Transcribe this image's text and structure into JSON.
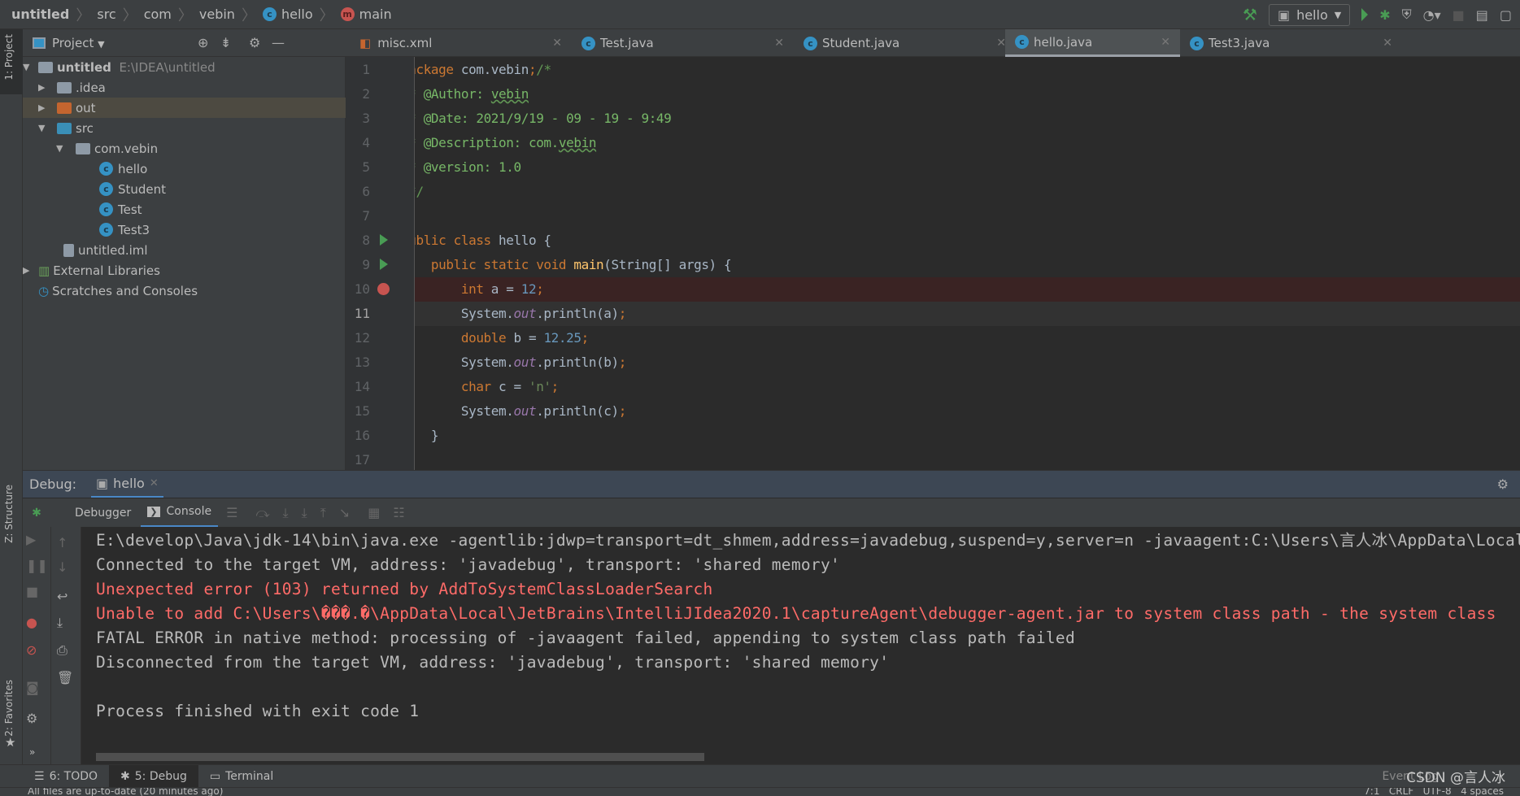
{
  "navbar": {
    "crumbs": [
      "untitled",
      "src",
      "com",
      "vebin",
      "hello",
      "main"
    ]
  },
  "toolbar": {
    "run_config": "hello"
  },
  "sidebar": {
    "project_tab": "1: Project",
    "structure_tab": "Z: Structure",
    "favorites_tab": "2: Favorites"
  },
  "project": {
    "title": "Project",
    "items": [
      {
        "label": "untitled",
        "path": "E:\\IDEA\\untitled"
      },
      {
        "label": ".idea"
      },
      {
        "label": "out"
      },
      {
        "label": "src"
      },
      {
        "label": "com.vebin"
      },
      {
        "label": "hello"
      },
      {
        "label": "Student"
      },
      {
        "label": "Test"
      },
      {
        "label": "Test3"
      },
      {
        "label": "untitled.iml"
      },
      {
        "label": "External Libraries"
      },
      {
        "label": "Scratches and Consoles"
      }
    ]
  },
  "tabs": [
    {
      "label": "misc.xml"
    },
    {
      "label": "Test.java"
    },
    {
      "label": "Student.java"
    },
    {
      "label": "hello.java",
      "active": true
    },
    {
      "label": "Test3.java"
    }
  ],
  "editor": {
    "current_line": 11,
    "breakpoint_line": 10,
    "lines": [
      [
        [
          "package",
          "kw"
        ],
        [
          " com.vebin",
          "pl"
        ],
        [
          ";",
          "kw"
        ],
        [
          "/*",
          "cm"
        ]
      ],
      [
        [
          " * ",
          "cm"
        ],
        [
          "@Author",
          "cmd"
        ],
        [
          ": ",
          "cmd"
        ],
        [
          "vebin",
          "cmd un"
        ]
      ],
      [
        [
          " * ",
          "cm"
        ],
        [
          "@Date",
          "cmd"
        ],
        [
          ": 2021/9/19 - 09 - 19 - 9:49",
          "cmd"
        ]
      ],
      [
        [
          " * ",
          "cm"
        ],
        [
          "@Description",
          "cmd"
        ],
        [
          ": com.",
          "cmd"
        ],
        [
          "vebin",
          "cmd un"
        ]
      ],
      [
        [
          " * ",
          "cm"
        ],
        [
          "@version",
          "cmd"
        ],
        [
          ": 1.0",
          "cmd"
        ]
      ],
      [
        [
          " */",
          "cm"
        ]
      ],
      [],
      [
        [
          "public class ",
          "kw"
        ],
        [
          "hello {",
          "pl"
        ]
      ],
      [
        [
          "    public static void ",
          "kw"
        ],
        [
          "main",
          "fn"
        ],
        [
          "(String[] args) {",
          "pl"
        ]
      ],
      [
        [
          "        int ",
          "kw"
        ],
        [
          "a = ",
          "pl"
        ],
        [
          "12",
          "num"
        ],
        [
          ";",
          "kw"
        ]
      ],
      [
        [
          "        System.",
          "pl"
        ],
        [
          "out",
          "fld"
        ],
        [
          ".println(a)",
          "pl"
        ],
        [
          ";",
          "kw"
        ]
      ],
      [
        [
          "        double ",
          "kw"
        ],
        [
          "b = ",
          "pl"
        ],
        [
          "12.25",
          "num"
        ],
        [
          ";",
          "kw"
        ]
      ],
      [
        [
          "        System.",
          "pl"
        ],
        [
          "out",
          "fld"
        ],
        [
          ".println(b)",
          "pl"
        ],
        [
          ";",
          "kw"
        ]
      ],
      [
        [
          "        char ",
          "kw"
        ],
        [
          "c = ",
          "pl"
        ],
        [
          "'n'",
          "str"
        ],
        [
          ";",
          "kw"
        ]
      ],
      [
        [
          "        System.",
          "pl"
        ],
        [
          "out",
          "fld"
        ],
        [
          ".println(c)",
          "pl"
        ],
        [
          ";",
          "kw"
        ]
      ],
      [
        [
          "    }",
          "pl"
        ]
      ],
      [
        [
          "}",
          "pl"
        ]
      ]
    ]
  },
  "debug": {
    "label": "Debug:",
    "session": "hello",
    "debugger_tab": "Debugger",
    "console_tab": "Console"
  },
  "console": {
    "lines": [
      {
        "text": "E:\\develop\\Java\\jdk-14\\bin\\java.exe -agentlib:jdwp=transport=dt_shmem,address=javadebug,suspend=y,server=n -javaagent:C:\\Users\\言人冰\\AppData\\Local",
        "err": false
      },
      {
        "text": "Connected to the target VM, address: 'javadebug', transport: 'shared memory'",
        "err": false
      },
      {
        "text": "Unexpected error (103) returned by AddToSystemClassLoaderSearch",
        "err": true
      },
      {
        "text": "Unable to add C:\\Users\\���.�\\AppData\\Local\\JetBrains\\IntelliJIdea2020.1\\captureAgent\\debugger-agent.jar to system class path - the system class",
        "err": true
      },
      {
        "text": "FATAL ERROR in native method: processing of -javaagent failed, appending to system class path failed",
        "err": false
      },
      {
        "text": "Disconnected from the target VM, address: 'javadebug', transport: 'shared memory'",
        "err": false
      },
      {
        "text": "",
        "err": false
      },
      {
        "text": "Process finished with exit code 1",
        "err": false
      }
    ]
  },
  "bottom_tabs": [
    {
      "label": "6: TODO"
    },
    {
      "label": "5: Debug",
      "active": true
    },
    {
      "label": "Terminal"
    }
  ],
  "status": {
    "message": "All files are up-to-date (20 minutes ago)",
    "right": "7:1   CRLF   UTF-8   4 spaces",
    "event_log": "Event Log",
    "watermark": "CSDN @言人冰"
  },
  "colors": {
    "keyword": "#cc7832",
    "comment": "#629755",
    "number": "#6897bb",
    "error": "#ff6b68",
    "breakpoint": "#c75450",
    "run": "#499c54"
  }
}
